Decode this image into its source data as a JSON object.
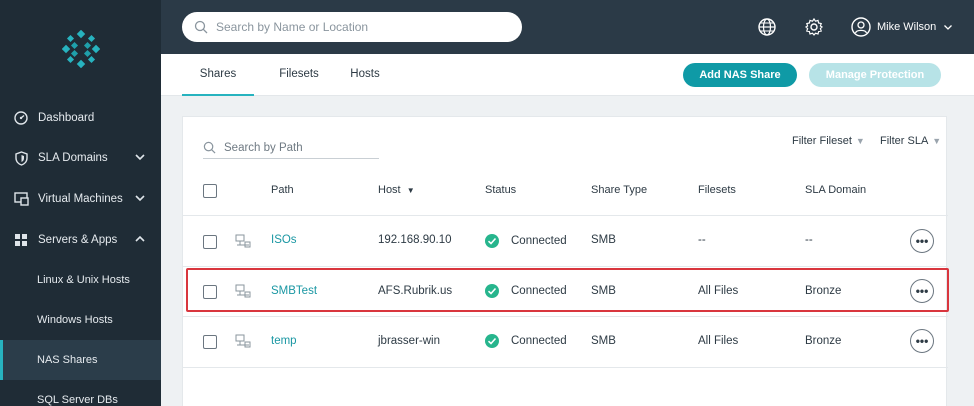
{
  "sidebar": {
    "items": [
      {
        "label": "Dashboard"
      },
      {
        "label": "SLA Domains"
      },
      {
        "label": "Virtual Machines"
      },
      {
        "label": "Servers & Apps"
      }
    ],
    "sub_items": [
      {
        "label": "Linux & Unix Hosts"
      },
      {
        "label": "Windows Hosts"
      },
      {
        "label": "NAS Shares"
      },
      {
        "label": "SQL Server DBs"
      }
    ]
  },
  "topbar": {
    "search_placeholder": "Search by Name or Location",
    "user_name": "Mike Wilson"
  },
  "tabs": [
    {
      "label": "Shares"
    },
    {
      "label": "Filesets"
    },
    {
      "label": "Hosts"
    }
  ],
  "actions": {
    "add_nas_share": "Add NAS Share",
    "manage_protection": "Manage Protection"
  },
  "table": {
    "path_search_placeholder": "Search by Path",
    "filter_fileset": "Filter Fileset",
    "filter_sla": "Filter SLA",
    "headers": {
      "path": "Path",
      "host": "Host",
      "status": "Status",
      "share_type": "Share Type",
      "filesets": "Filesets",
      "sla_domain": "SLA Domain"
    },
    "rows": [
      {
        "path": "ISOs",
        "host": "192.168.90.10",
        "status": "Connected",
        "share_type": "SMB",
        "filesets": "--",
        "sla_domain": "--"
      },
      {
        "path": "SMBTest",
        "host": "AFS.Rubrik.us",
        "status": "Connected",
        "share_type": "SMB",
        "filesets": "All Files",
        "sla_domain": "Bronze"
      },
      {
        "path": "temp",
        "host": "jbrasser-win",
        "status": "Connected",
        "share_type": "SMB",
        "filesets": "All Files",
        "sla_domain": "Bronze"
      }
    ]
  },
  "colors": {
    "accent": "#27b3bf",
    "primary_button": "#0f9aa6",
    "status_ok": "#27b58d",
    "highlight": "#d9363e",
    "sidebar_bg": "#1f2c36"
  }
}
